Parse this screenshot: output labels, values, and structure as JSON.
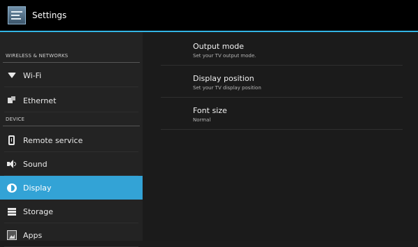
{
  "app": {
    "title": "Settings"
  },
  "sidebar": {
    "sections": [
      {
        "header": "WIRELESS & NETWORKS"
      },
      {
        "header": "DEVICE"
      }
    ],
    "items": [
      {
        "label": "Wi-Fi",
        "icon": "wifi-icon"
      },
      {
        "label": "Ethernet",
        "icon": "ethernet-icon"
      },
      {
        "label": "Remote service",
        "icon": "phone-icon"
      },
      {
        "label": "Sound",
        "icon": "speaker-icon"
      },
      {
        "label": "Display",
        "icon": "display-icon",
        "selected": true
      },
      {
        "label": "Storage",
        "icon": "storage-icon"
      },
      {
        "label": "Apps",
        "icon": "apps-icon"
      }
    ]
  },
  "display_settings": {
    "items": [
      {
        "title": "Output mode",
        "summary": "Set your TV output mode."
      },
      {
        "title": "Display position",
        "summary": "Set your TV display position"
      },
      {
        "title": "Font size",
        "summary": "Normal"
      }
    ]
  },
  "colors": {
    "accent": "#33b5e5",
    "selected": "#33a3d6"
  }
}
